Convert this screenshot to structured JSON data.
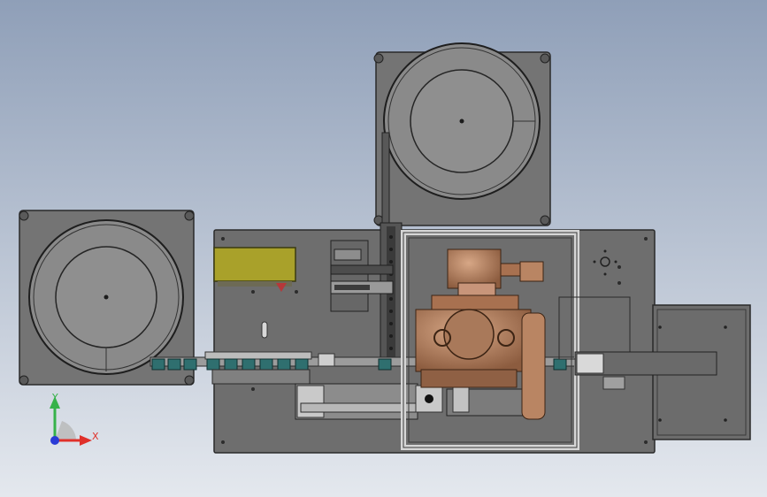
{
  "viewport": {
    "background_top": "#8f9fb8",
    "background_bottom": "#e4e8ee"
  },
  "colors": {
    "plate": "#6f6f6f",
    "plate_edge": "#2a2a2a",
    "bowl": "#878787",
    "bowl_inner": "#939393",
    "rail": "#9a9a9a",
    "teal_part": "#2f6f6f",
    "copper": "#b98563",
    "copper_dark": "#8c5c3f",
    "olive_box": "#a9a12a",
    "frame": "#d2d2d2",
    "output_tray": "#6c6c6c"
  },
  "icons": {
    "triad": "coordinate-triad-icon",
    "bowl_feeder_top": "vibratory-bowl-icon",
    "bowl_feeder_left": "vibratory-bowl-icon"
  },
  "triad": {
    "x_label": "X",
    "y_label": "Y",
    "x_color": "#e0302a",
    "y_color": "#36b24a",
    "z_color": "#2a3bd6"
  }
}
